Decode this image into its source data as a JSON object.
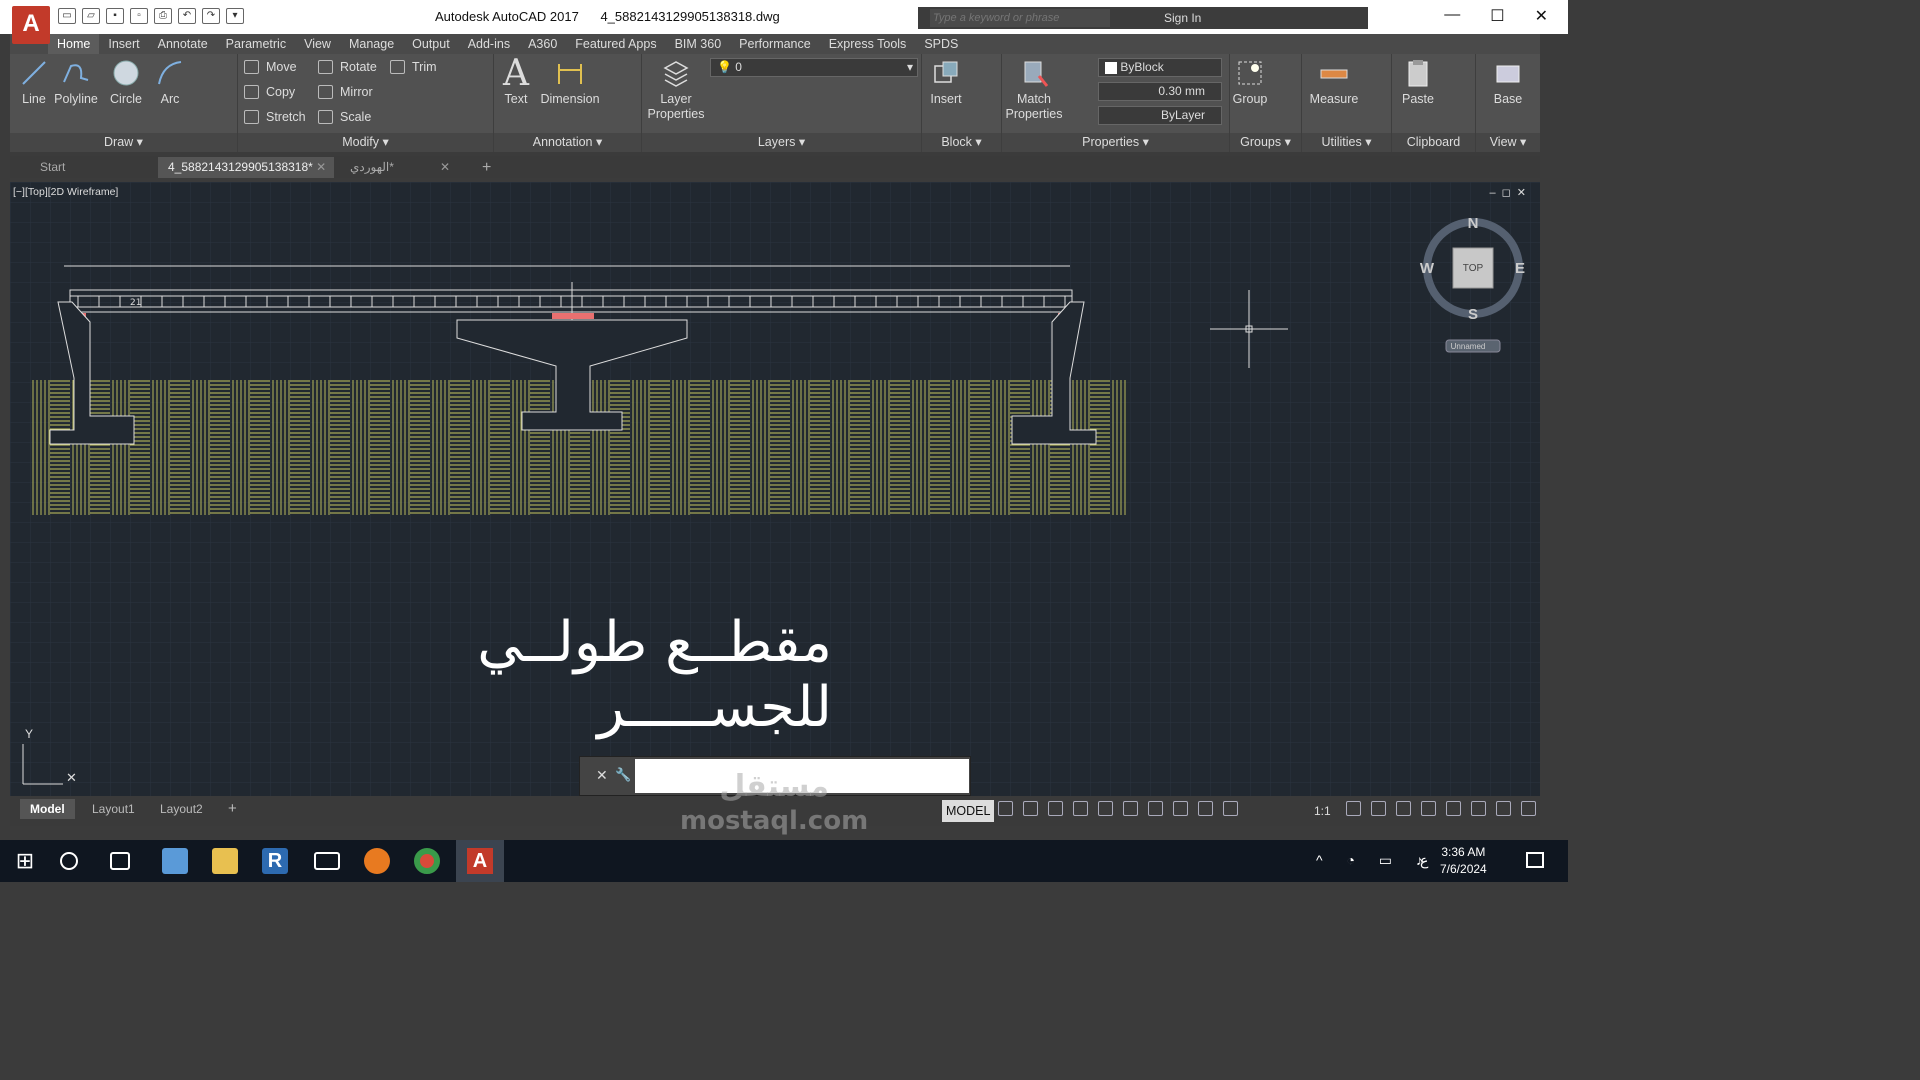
{
  "window": {
    "app": "Autodesk AutoCAD 2017",
    "file": "4_5882143129905138318.dwg",
    "search_placeholder": "Type a keyword or phrase",
    "sign_in": "Sign In"
  },
  "ribbon_tabs": [
    "Home",
    "Insert",
    "Annotate",
    "Parametric",
    "View",
    "Manage",
    "Output",
    "Add-ins",
    "A360",
    "Featured Apps",
    "BIM 360",
    "Performance",
    "Express Tools",
    "SPDS"
  ],
  "draw": {
    "title": "Draw",
    "line": "Line",
    "polyline": "Polyline",
    "circle": "Circle",
    "arc": "Arc"
  },
  "modify": {
    "title": "Modify",
    "move": "Move",
    "rotate": "Rotate",
    "trim": "Trim",
    "copy": "Copy",
    "mirror": "Mirror",
    "stretch": "Stretch",
    "scale": "Scale"
  },
  "annotation": {
    "title": "Annotation",
    "text": "Text",
    "dimension": "Dimension"
  },
  "layers": {
    "title": "Layers",
    "layer_properties": "Layer Properties",
    "current_layer": "0"
  },
  "block": {
    "title": "Block",
    "insert": "Insert"
  },
  "properties": {
    "title": "Properties",
    "match": "Match Properties",
    "color": "ByBlock",
    "lineweight": "0.30 mm",
    "linetype": "ByLayer"
  },
  "groups": {
    "title": "Groups",
    "group": "Group"
  },
  "utilities": {
    "title": "Utilities",
    "measure": "Measure"
  },
  "clipboard": {
    "title": "Clipboard",
    "paste": "Paste"
  },
  "view": {
    "title": "View",
    "base": "Base"
  },
  "doc_tabs": {
    "start": "Start",
    "active": "4_5882143129905138318*",
    "other": "الهوردي*"
  },
  "viewport": {
    "label": "[−][Top][2D Wireframe]",
    "compass": {
      "n": "N",
      "s": "S",
      "e": "E",
      "w": "W",
      "top": "TOP"
    },
    "ucs_name": "Unnamed",
    "dim_text": "21"
  },
  "drawing_title": "مقطــع طولــي للجســـــر",
  "layout_tabs": [
    "Model",
    "Layout1",
    "Layout2"
  ],
  "status": {
    "model": "MODEL",
    "scale": "1:1"
  },
  "taskbar": {
    "time": "3:36 AM",
    "date": "7/6/2024",
    "lang": "ع"
  },
  "watermark": {
    "line1": "مستقل",
    "line2": "mostaql.com"
  }
}
